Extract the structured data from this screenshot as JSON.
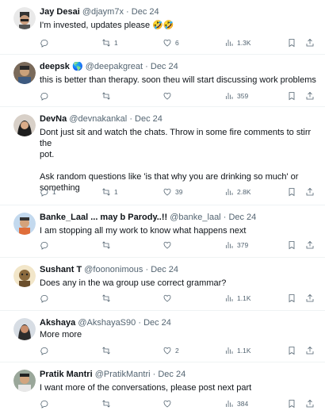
{
  "tweets": [
    {
      "name": "Jay Desai",
      "handle": "@djaym7x",
      "date": "Dec 24",
      "text_lines": [
        "I'm invested, updates please 🤣🤣"
      ],
      "replies": "",
      "reposts": "1",
      "likes": "6",
      "views": "1.3K"
    },
    {
      "name": "deepsk",
      "handle": "@deepakgreat",
      "date": "Dec 24",
      "text_lines": [
        "this is better than therapy. soon theu will start discussing work problems"
      ],
      "replies": "",
      "reposts": "",
      "likes": "",
      "views": "359"
    },
    {
      "name": "DevNa",
      "handle": "@devnakankal",
      "date": "Dec 24",
      "text_lines": [
        "Dont just sit and watch the chats. Throw in some fire comments to stirr the",
        "pot.",
        "",
        "Ask random questions like 'is that why you are drinking so much' or",
        "something"
      ],
      "replies": "1",
      "reposts": "1",
      "likes": "39",
      "views": "2.8K"
    },
    {
      "name": "Banke_Laal ... may b Parody..!!",
      "handle": "@banke_laal",
      "date": "Dec 24",
      "text_lines": [
        "I am stopping all my work to know what happens next"
      ],
      "replies": "",
      "reposts": "",
      "likes": "",
      "views": "379"
    },
    {
      "name": "Sushant T",
      "handle": "@foononimous",
      "date": "Dec 24",
      "text_lines": [
        "Does any in the wa group use correct grammar?"
      ],
      "replies": "",
      "reposts": "",
      "likes": "",
      "views": "1.1K"
    },
    {
      "name": "Akshaya",
      "handle": "@AkshayaS90",
      "date": "Dec 24",
      "text_lines": [
        "More more"
      ],
      "replies": "",
      "reposts": "",
      "likes": "2",
      "views": "1.1K"
    },
    {
      "name": "Pratik Mantri",
      "handle": "@PratikMantri",
      "date": "Dec 24",
      "text_lines": [
        "I want more of the conversations, please post next part"
      ],
      "replies": "",
      "reposts": "",
      "likes": "",
      "views": "384"
    }
  ],
  "colors": {
    "text": "#0f1419",
    "muted": "#536471",
    "divider": "#eff3f4",
    "verified": "#1d9bf0"
  },
  "icons": [
    "reply-icon",
    "repost-icon",
    "like-icon",
    "views-icon",
    "bookmark-icon",
    "share-icon"
  ]
}
